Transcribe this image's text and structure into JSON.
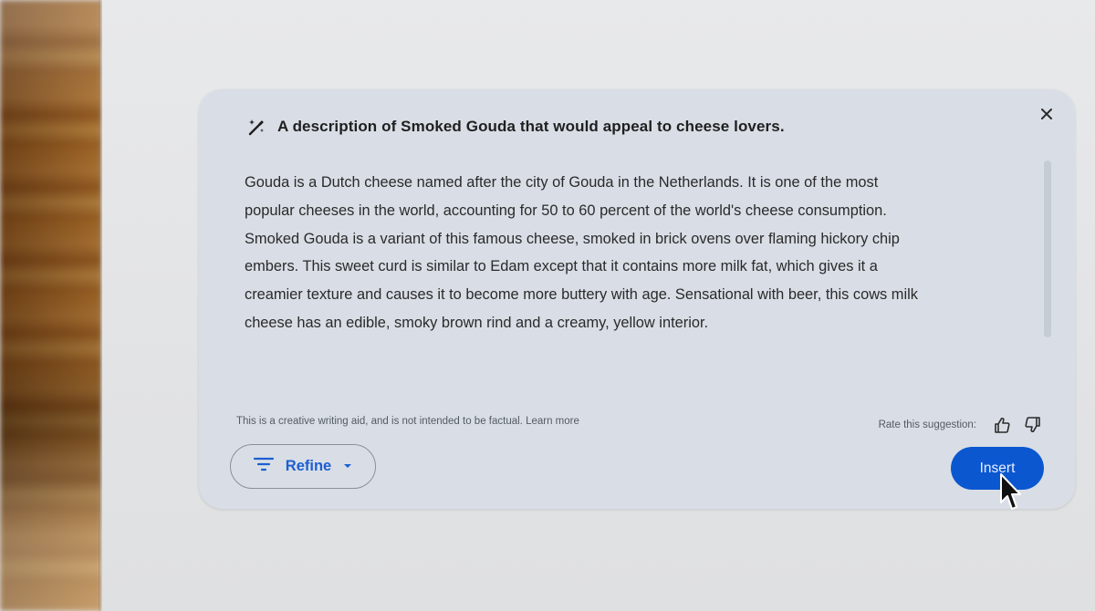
{
  "prompt": {
    "title": "A description of Smoked Gouda that would appeal to cheese lovers.",
    "icon": "magic-wand-icon"
  },
  "suggestion": {
    "lines": [
      "Gouda is a Dutch cheese named after the city of Gouda in the Netherlands. It is one of the most",
      "popular cheeses in the world, accounting for 50 to 60 percent of the world's cheese consumption.",
      "Smoked Gouda is a variant of this famous cheese, smoked in brick ovens over flaming hickory chip",
      "embers. This sweet curd is similar to Edam except that it contains more milk fat, which gives it a",
      "creamier texture and causes it to become more buttery with age. Sensational with beer, this cows milk",
      "cheese has an edible, smoky brown rind and a creamy, yellow interior."
    ]
  },
  "footer": {
    "disclaimer": "This is a creative writing aid, and is not intended to be factual.",
    "learn_more": "Learn more",
    "rate_label": "Rate this suggestion:",
    "refine_label": "Refine",
    "insert_label": "Insert"
  },
  "colors": {
    "accent": "#0b57d0",
    "card": "#d9dee6",
    "backdrop": "#e4e5e7"
  }
}
